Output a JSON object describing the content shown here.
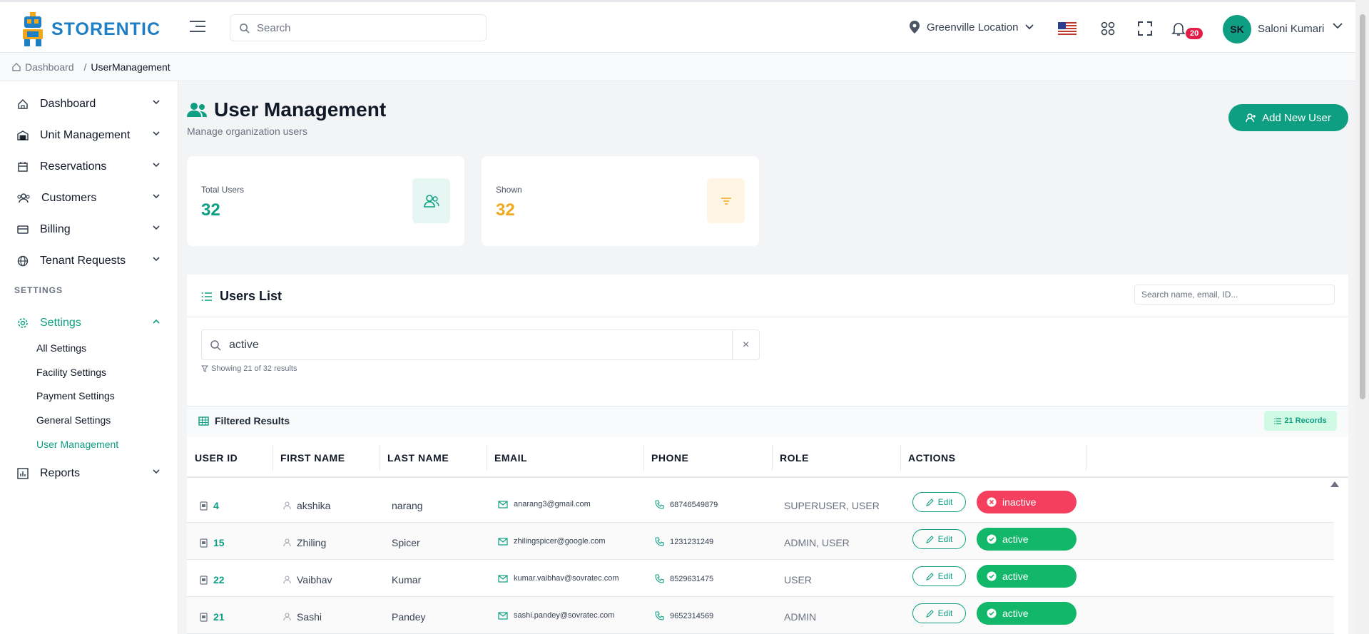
{
  "brand": {
    "name": "STORENTIC"
  },
  "header": {
    "search_placeholder": "Search",
    "location": "Greenville Location",
    "notifications": "20",
    "avatar_initials": "SK",
    "user_name": "Saloni Kumari"
  },
  "breadcrumb": {
    "home": "Dashboard",
    "separator": "/",
    "current": "UserManagement"
  },
  "sidebar": {
    "items": [
      {
        "label": "Dashboard",
        "icon": "home-icon"
      },
      {
        "label": "Unit Management",
        "icon": "warehouse-icon"
      },
      {
        "label": "Reservations",
        "icon": "calendar-icon"
      },
      {
        "label": "Customers",
        "icon": "users-icon"
      },
      {
        "label": "Billing",
        "icon": "credit-card-icon"
      },
      {
        "label": "Tenant Requests",
        "icon": "globe-icon"
      }
    ],
    "section": "SETTINGS",
    "settings": {
      "label": "Settings",
      "sub": [
        "All Settings",
        "Facility Settings",
        "Payment Settings",
        "General Settings",
        "User Management"
      ]
    },
    "reports": "Reports"
  },
  "page": {
    "title": "User Management",
    "subtitle": "Manage organization users",
    "add_button": "Add New User"
  },
  "stats": [
    {
      "label": "Total Users",
      "value": "32",
      "color": "#0e9f83"
    },
    {
      "label": "Shown",
      "value": "32",
      "color": "#f0a81e"
    }
  ],
  "users_list": {
    "title": "Users List",
    "search_placeholder": "Search name, email, ID...",
    "filter_value": "active",
    "clear": "×",
    "showing": "Showing 21 of 32 results"
  },
  "results": {
    "title": "Filtered Results",
    "records": "21 Records"
  },
  "table": {
    "columns": [
      "USER ID",
      "FIRST NAME",
      "LAST NAME",
      "EMAIL",
      "PHONE",
      "ROLE",
      "ACTIONS"
    ],
    "edit_label": "Edit",
    "rows": [
      {
        "id": "4",
        "first": "akshika",
        "last": "narang",
        "email": "anarang3@gmail.com",
        "phone": "68746549879",
        "role": "SUPERUSER, USER",
        "status": "inactive"
      },
      {
        "id": "15",
        "first": "Zhiling",
        "last": "Spicer",
        "email": "zhilingspicer@google.com",
        "phone": "1231231249",
        "role": "ADMIN, USER",
        "status": "active"
      },
      {
        "id": "22",
        "first": "Vaibhav",
        "last": "Kumar",
        "email": "kumar.vaibhav@sovratec.com",
        "phone": "8529631475",
        "role": "USER",
        "status": "active"
      },
      {
        "id": "21",
        "first": "Sashi",
        "last": "Pandey",
        "email": "sashi.pandey@sovratec.com",
        "phone": "9652314569",
        "role": "ADMIN",
        "status": "active"
      }
    ]
  },
  "colors": {
    "accent": "#0e9f83",
    "active": "#12b76a",
    "inactive": "#f43f5e",
    "brand": "#1e7fc4"
  }
}
